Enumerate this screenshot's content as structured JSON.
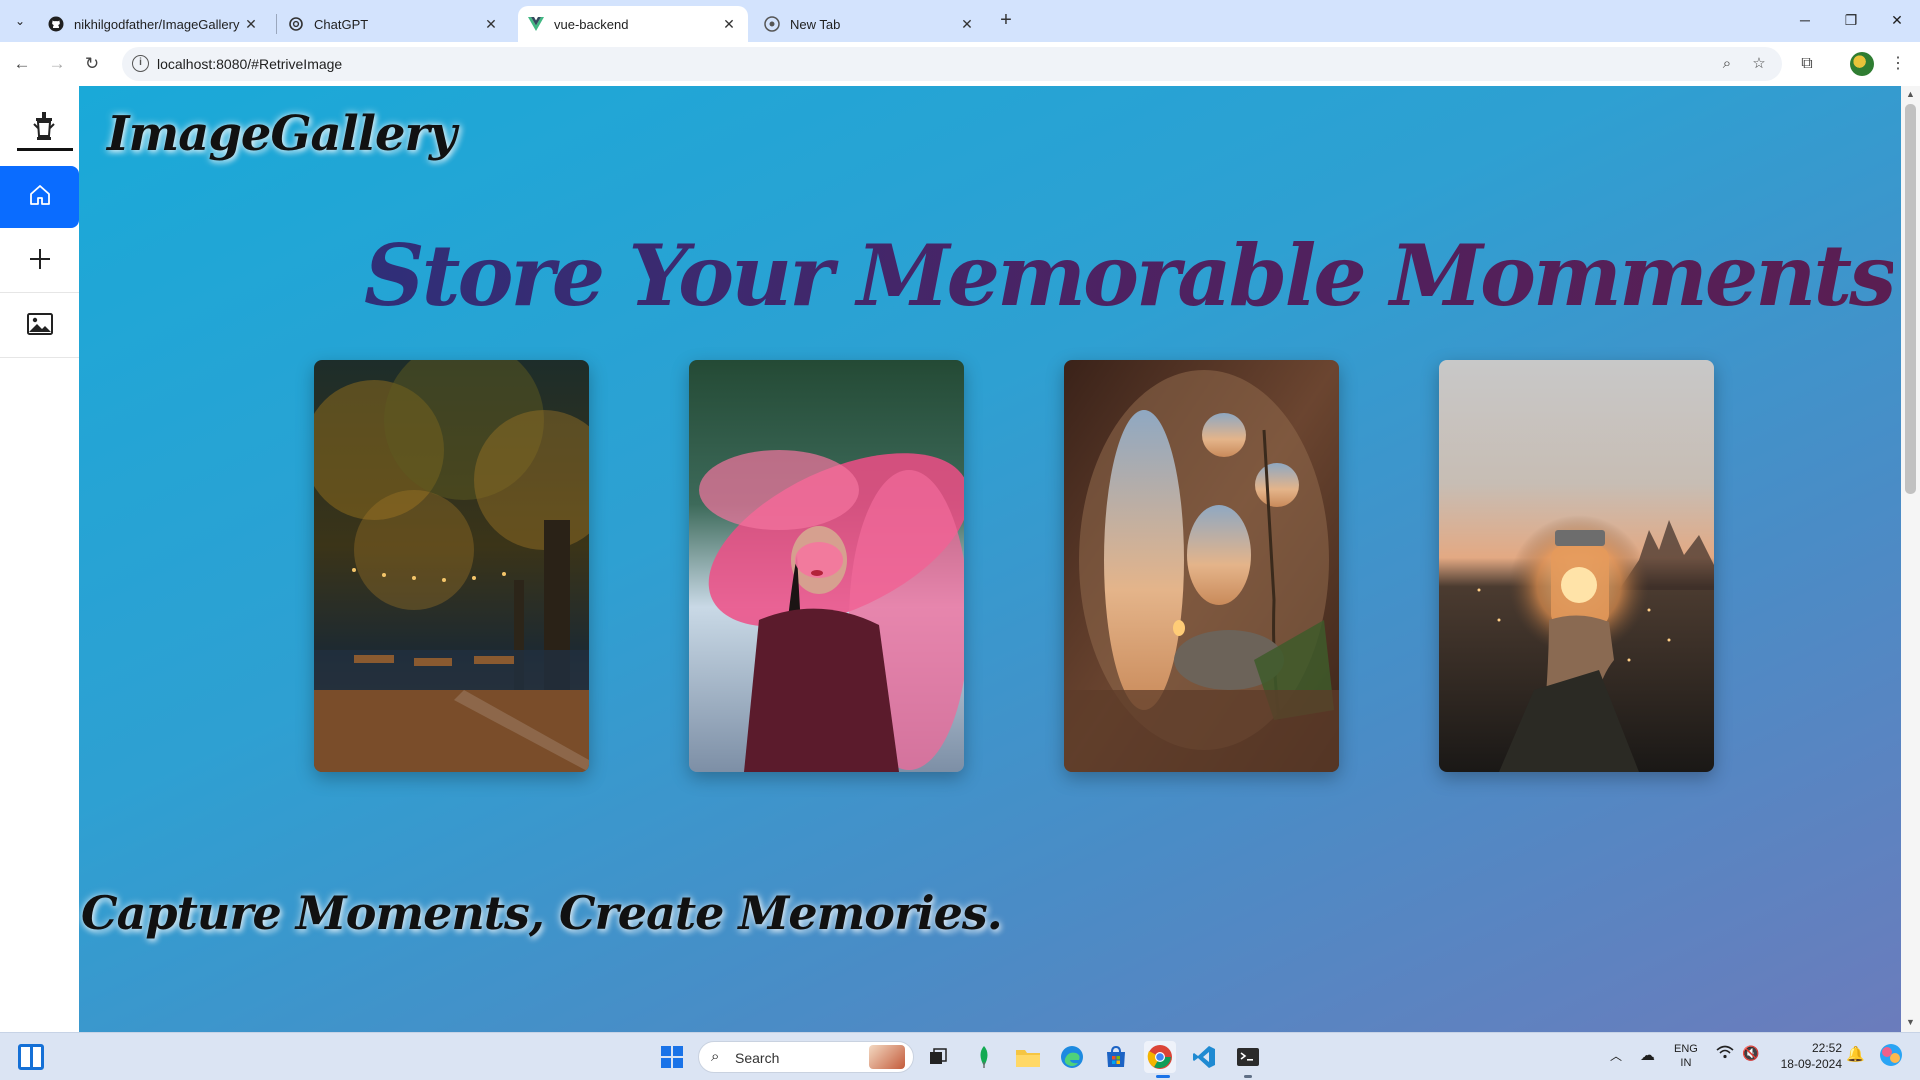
{
  "browser": {
    "tabs": [
      {
        "title": "nikhilgodfather/ImageGallery",
        "favicon": "github-icon"
      },
      {
        "title": "ChatGPT",
        "favicon": "chatgpt-icon"
      },
      {
        "title": "vue-backend",
        "favicon": "vue-icon"
      },
      {
        "title": "New Tab",
        "favicon": "chrome-icon"
      }
    ],
    "active_tab": 2,
    "url": "localhost:8080/#RetriveImage"
  },
  "sidebar": {
    "items": [
      {
        "name": "home",
        "icon": "home-icon",
        "active": true
      },
      {
        "name": "add",
        "icon": "plus-icon",
        "active": false
      },
      {
        "name": "gallery",
        "icon": "image-icon",
        "active": false
      }
    ]
  },
  "page": {
    "brand": "ImageGallery",
    "hero": "Store Your Memorable Momments",
    "tagline": "Capture Moments, Create Memories.",
    "cards": [
      {
        "subject": "autumn park street at night with string lights"
      },
      {
        "subject": "woman in maroon coat with pink smoke"
      },
      {
        "subject": "round windows interior at sunset"
      },
      {
        "subject": "hand holding glowing jar at dusk"
      }
    ]
  },
  "taskbar": {
    "search_label": "Search",
    "language": "ENG",
    "region": "IN",
    "time": "22:52",
    "date": "18-09-2024"
  },
  "colors": {
    "page_gradient_start": "#1aa9d8",
    "page_gradient_end": "#6b7cbc",
    "sidebar_active": "#0a6cff",
    "hero_text": "#3d2365"
  }
}
